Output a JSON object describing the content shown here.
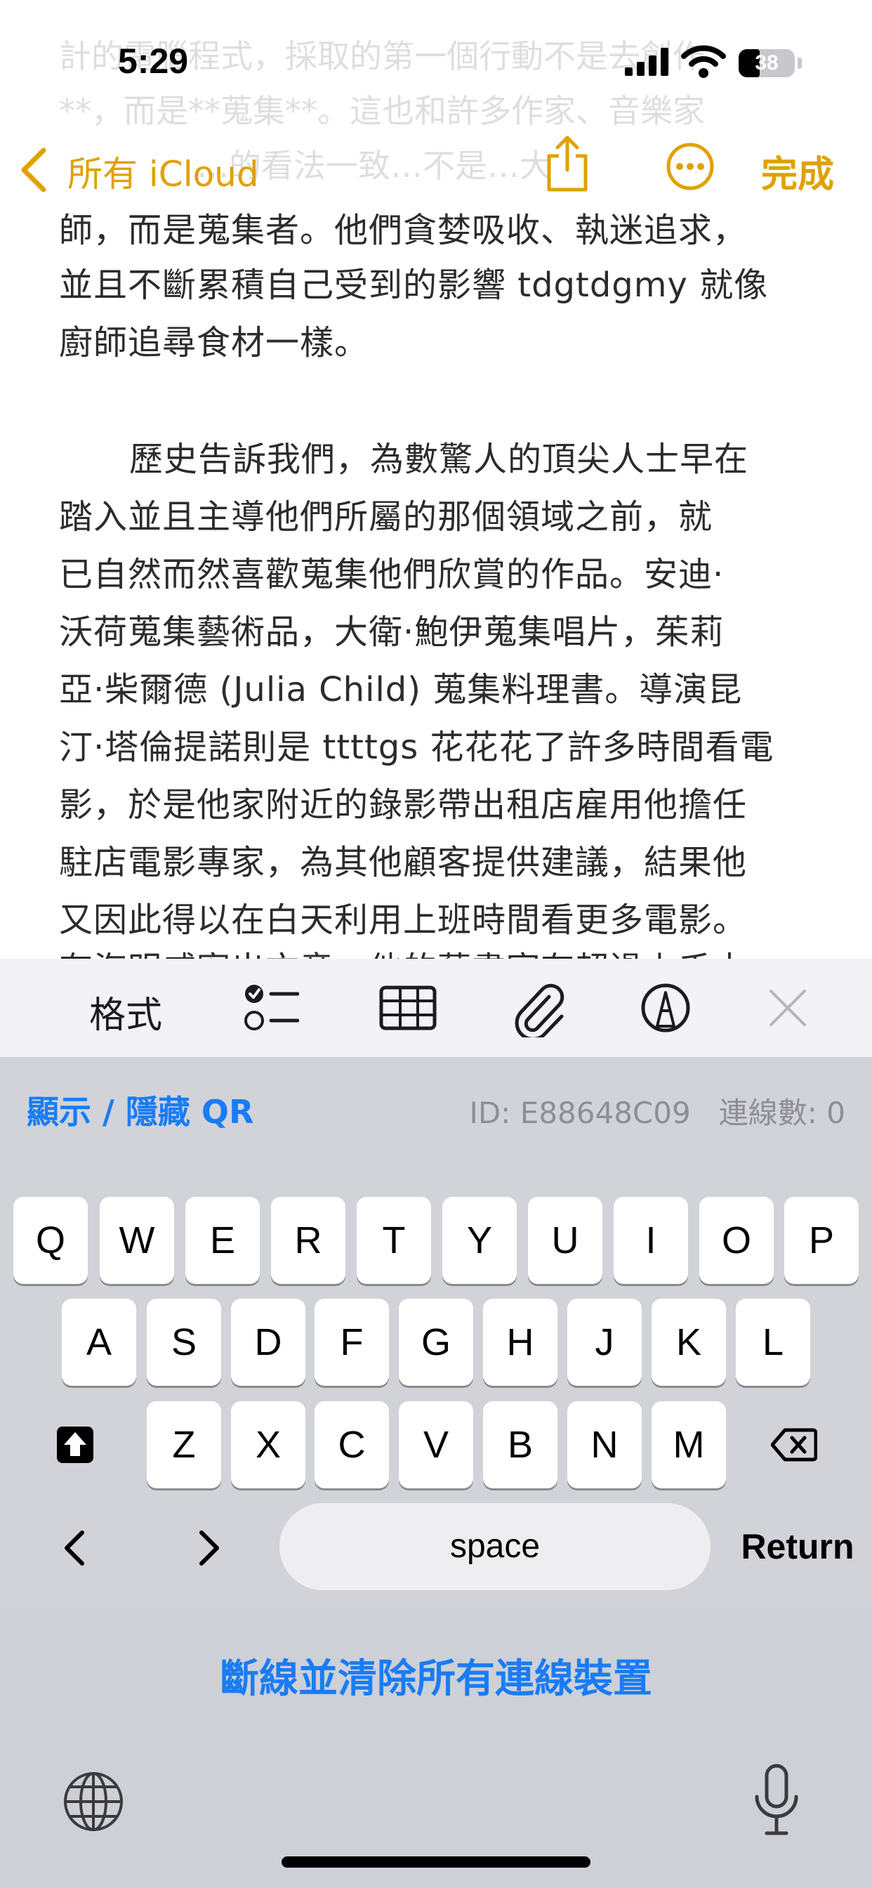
{
  "status": {
    "time": "5:29",
    "battery": "38",
    "battery_level": 0.38
  },
  "nav": {
    "back_label": "所有 iCloud",
    "done_label": "完成"
  },
  "note": {
    "faded_lines": [
      "計的電腦程式，採取的第一個行動不是去創作",
      "**，而是**蒐集**。這也和許多作家、音樂家",
      "…的看法一致…不是…大"
    ],
    "partial_line": "師，而是蒐集者。他們貪婪吸收、執迷追求，",
    "lines": [
      "並且不斷累積自己受到的影響 tdgtdgmy  就像",
      "廚師追尋食材一樣。",
      "歷史告訴我們，為數驚人的頂尖人士早在",
      "踏入並且主導他們所屬的那個領域之前，就",
      "已自然而然喜歡蒐集他們欣賞的作品。安迪·",
      "沃荷蒐集藝術品，大衛·鮑伊蒐集唱片，茱莉",
      "亞·柴爾德 (Julia Child) 蒐集料理書。導演昆",
      "汀·塔倫提諾則是 ttttgs 花花花了許多時間看電",
      "影，於是他家附近的錄影帶出租店雇用他擔任",
      "駐店電影專家，為其他顧客提供建議，結果他",
      "又因此得以在白天利用上班時間看更多電影。"
    ],
    "cut_line": "有海明威寫出文章，他的藝書室有超過上千本"
  },
  "toolbar": {
    "format_label": "格式"
  },
  "qr_bar": {
    "toggle_label": "顯示 / 隱藏 QR",
    "id_text": "ID: E88648C09",
    "connections_text": "連線數: 0"
  },
  "keyboard": {
    "row1": [
      "Q",
      "W",
      "E",
      "R",
      "T",
      "Y",
      "U",
      "I",
      "O",
      "P"
    ],
    "row2": [
      "A",
      "S",
      "D",
      "F",
      "G",
      "H",
      "J",
      "K",
      "L"
    ],
    "row3": [
      "Z",
      "X",
      "C",
      "V",
      "B",
      "N",
      "M"
    ],
    "space_label": "space",
    "return_label": "Return",
    "prev_label": "‹",
    "next_label": "›"
  },
  "disconnect": {
    "label": "斷線並清除所有連線裝置"
  },
  "accent": "#e0a100",
  "link_color": "#1a7cf5"
}
